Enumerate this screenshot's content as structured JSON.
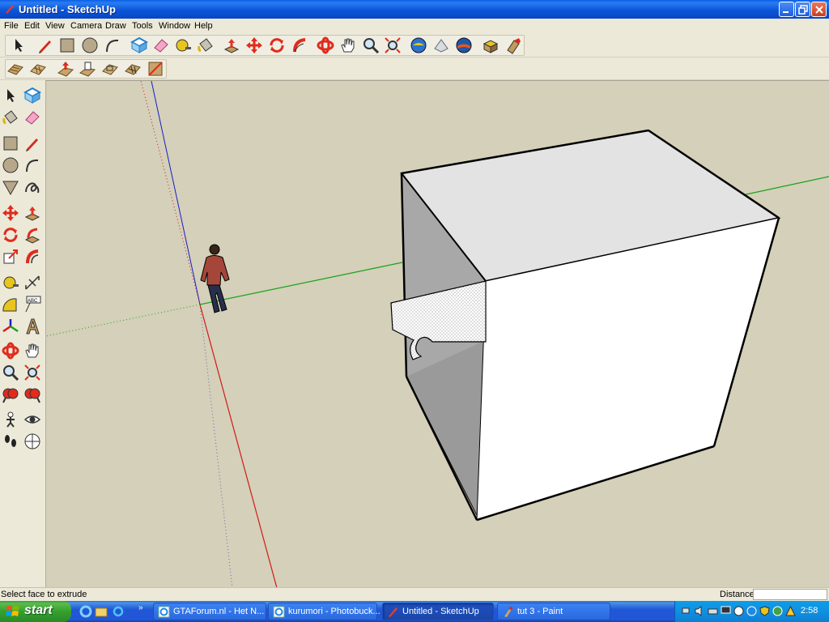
{
  "window": {
    "title": "Untitled - SketchUp"
  },
  "menu": [
    "File",
    "Edit",
    "View",
    "Camera",
    "Draw",
    "Tools",
    "Window",
    "Help"
  ],
  "toolbar_top": [
    "select-icon",
    "pencil-icon",
    "rectangle-icon",
    "circle-icon",
    "arc-icon",
    "make-component-icon",
    "eraser-icon",
    "tape-measure-icon",
    "paint-bucket-icon",
    "push-pull-icon",
    "move-icon",
    "rotate-icon",
    "follow-me-icon",
    "orbit-icon",
    "pan-icon",
    "zoom-icon",
    "zoom-extents-icon",
    "get-models-icon",
    "share-model-icon",
    "google-earth-icon",
    "components-icon",
    "materials-icon"
  ],
  "toolbar_second": [
    "sandbox-from-contours-icon",
    "sandbox-from-scratch-icon",
    "smoove-icon",
    "stamp-icon",
    "drape-icon",
    "add-detail-icon",
    "flip-edge-icon"
  ],
  "left_toolbar": [
    "select-icon",
    "make-component-icon",
    "paint-bucket-icon",
    "eraser-icon",
    "rectangle-icon",
    "pencil-icon",
    "circle-icon",
    "arc-icon",
    "polygon-icon",
    "freehand-icon",
    "move-icon",
    "push-pull-icon",
    "rotate-icon",
    "follow-me-icon",
    "scale-icon",
    "offset-icon",
    "tape-measure-icon",
    "dimension-icon",
    "protractor-icon",
    "text-icon",
    "axes-icon",
    "3d-text-icon",
    "orbit-icon",
    "pan-icon",
    "zoom-icon",
    "zoom-window-icon",
    "previous-view-icon",
    "next-view-icon",
    "position-camera-icon",
    "look-around-icon",
    "walk-icon",
    "section-plane-icon"
  ],
  "text_tool_label": "ABC",
  "status": {
    "message": "Select face to extrude",
    "measurement_label": "Distance",
    "measurement_value": ""
  },
  "taskbar": {
    "start_label": "start",
    "tasks": [
      {
        "label": "GTAForum.nl - Het N...",
        "icon": "ie-icon",
        "active": false
      },
      {
        "label": "kurumori - Photobuck...",
        "icon": "ie-icon",
        "active": false
      },
      {
        "label": "Untitled - SketchUp",
        "icon": "sketchup-icon",
        "active": true
      },
      {
        "label": "tut 3 - Paint",
        "icon": "paint-icon",
        "active": false
      }
    ],
    "clock": "2:58"
  },
  "colors": {
    "viewport_bg": "#d4d0b9",
    "axis_red": "#d21a1a",
    "axis_green": "#1aa21a",
    "axis_blue": "#1a1ac8",
    "title_blue": "#0b55d8",
    "taskbar_blue": "#2157d7",
    "start_green": "#34a02f"
  }
}
